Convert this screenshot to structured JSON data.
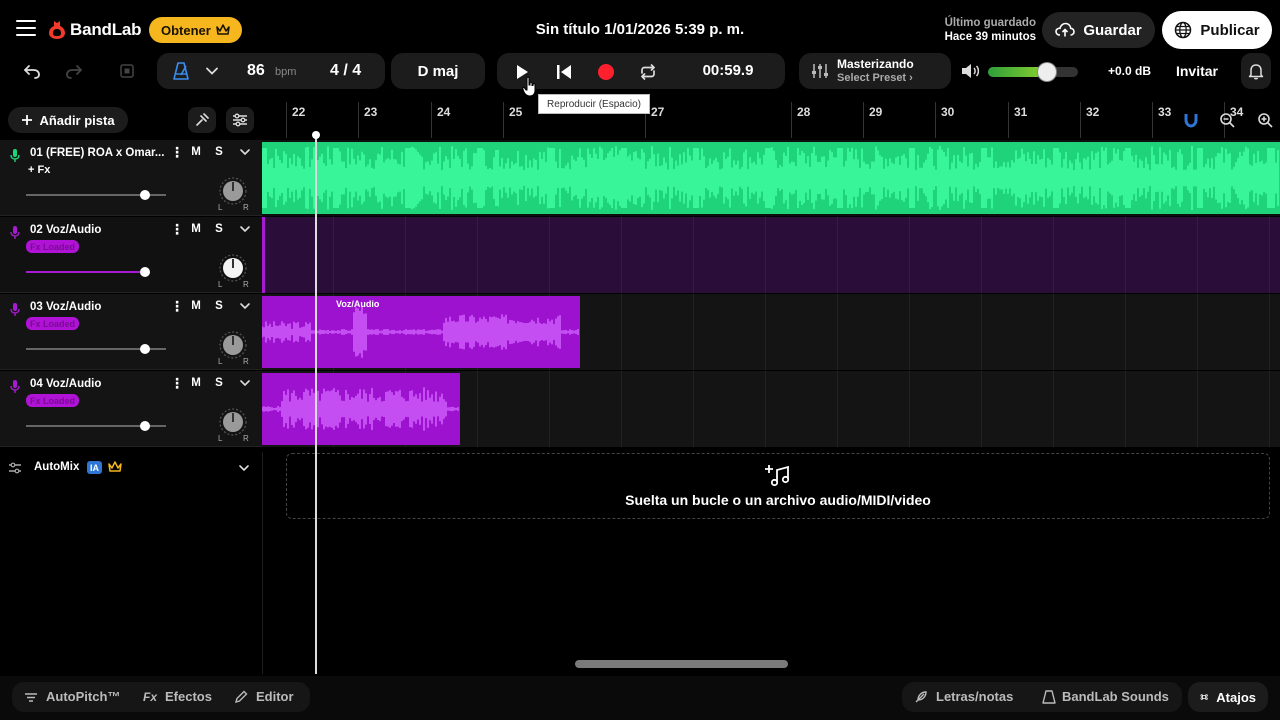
{
  "header": {
    "brand": "BandLab",
    "obtener": "Obtener",
    "title": "Sin título 1/01/2026 5:39 p. m.",
    "saved_label": "Último guardado",
    "saved_time": "Hace 39 minutos",
    "save_button": "Guardar",
    "publish_button": "Publicar"
  },
  "toolbar": {
    "bpm": "86",
    "bpm_unit": "bpm",
    "time_signature": "4 / 4",
    "key": "D maj",
    "time": "00:59.9",
    "mastering_title": "Masterizando",
    "mastering_preset": "Select Preset",
    "db": "+0.0 dB",
    "volume_level": 0.65,
    "invite": "Invitar",
    "tooltip": "Reproducir (Espacio)"
  },
  "sidebar": {
    "add_track": "Añadir pista",
    "automix": "AutoMix",
    "automix_badge": "IA"
  },
  "tracks": [
    {
      "name": "01 (FREE) ROA x Omar...",
      "mute": "M",
      "solo": "S",
      "fx": "+ Fx",
      "fader": 0.85,
      "color": "#1ed37a"
    },
    {
      "name": "02 Voz/Audio",
      "mute": "M",
      "solo": "S",
      "fx_badge": "Fx Loaded",
      "fader": 0.85,
      "color": "#a61ad1"
    },
    {
      "name": "03 Voz/Audio",
      "mute": "M",
      "solo": "S",
      "fx_badge": "Fx Loaded",
      "fader": 0.85,
      "color": "#a61ad1"
    },
    {
      "name": "04 Voz/Audio",
      "mute": "M",
      "solo": "S",
      "fx_badge": "Fx Loaded",
      "fader": 0.85,
      "color": "#a61ad1"
    }
  ],
  "timeline": {
    "bars": [
      "22",
      "23",
      "24",
      "25",
      "27",
      "28",
      "29",
      "30",
      "31",
      "32",
      "33",
      "34"
    ],
    "region_label": "Voz/Audio",
    "drop_text": "Suelta un bucle o un archivo audio/MIDI/video"
  },
  "bottom": {
    "autopitch": "AutoPitch™",
    "effects": "Efectos",
    "editor": "Editor",
    "lyrics": "Letras/notas",
    "sounds": "BandLab Sounds",
    "shortcuts": "Atajos"
  },
  "colors": {
    "accent_green": "#1ed37a",
    "accent_purple": "#a61ad1",
    "brand_red": "#f23a2b",
    "record_red": "#ff1f2d",
    "obtener_yellow": "#f6b61e"
  },
  "icons": [
    "menu-icon",
    "bandlab-logo-icon",
    "crown-icon",
    "cloud-upload-icon",
    "globe-icon",
    "undo-icon",
    "redo-icon",
    "metronome-icon",
    "play-icon",
    "skip-back-icon",
    "record-icon",
    "loop-icon",
    "mastering-icon",
    "volume-icon",
    "bell-icon",
    "mic-icon",
    "magnet-icon",
    "zoom-out-icon",
    "zoom-in-icon",
    "music-plus-icon"
  ]
}
